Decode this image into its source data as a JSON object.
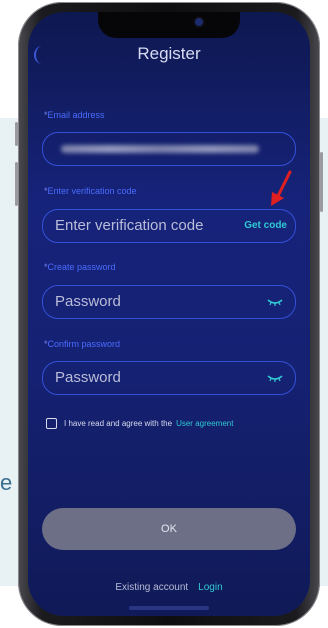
{
  "backdrop": {
    "letter": "e"
  },
  "header": {
    "title": "Register"
  },
  "form": {
    "email": {
      "label_star": "*",
      "label": "Email address"
    },
    "verification": {
      "label_star": "*",
      "label": "Enter verification code",
      "placeholder": "Enter verification code",
      "get_code": "Get code"
    },
    "password": {
      "label_star": "*",
      "label": "Create password",
      "placeholder": "Password"
    },
    "confirm": {
      "label_star": "*",
      "label": "Confirm password",
      "placeholder": "Password"
    },
    "agreement": {
      "text": "I have read and agree with the",
      "link": "User agreement",
      "checked": false
    },
    "ok_label": "OK"
  },
  "footer": {
    "existing_text": "Existing account",
    "login_link": "Login"
  },
  "colors": {
    "accent_cyan": "#31c9d4",
    "field_border": "#3550d8",
    "label_blue": "#4a6cff",
    "annotation_arrow": "#e02020"
  },
  "icons": {
    "password_toggle": "eye-closed-icon",
    "annotation": "red-arrow-icon"
  }
}
